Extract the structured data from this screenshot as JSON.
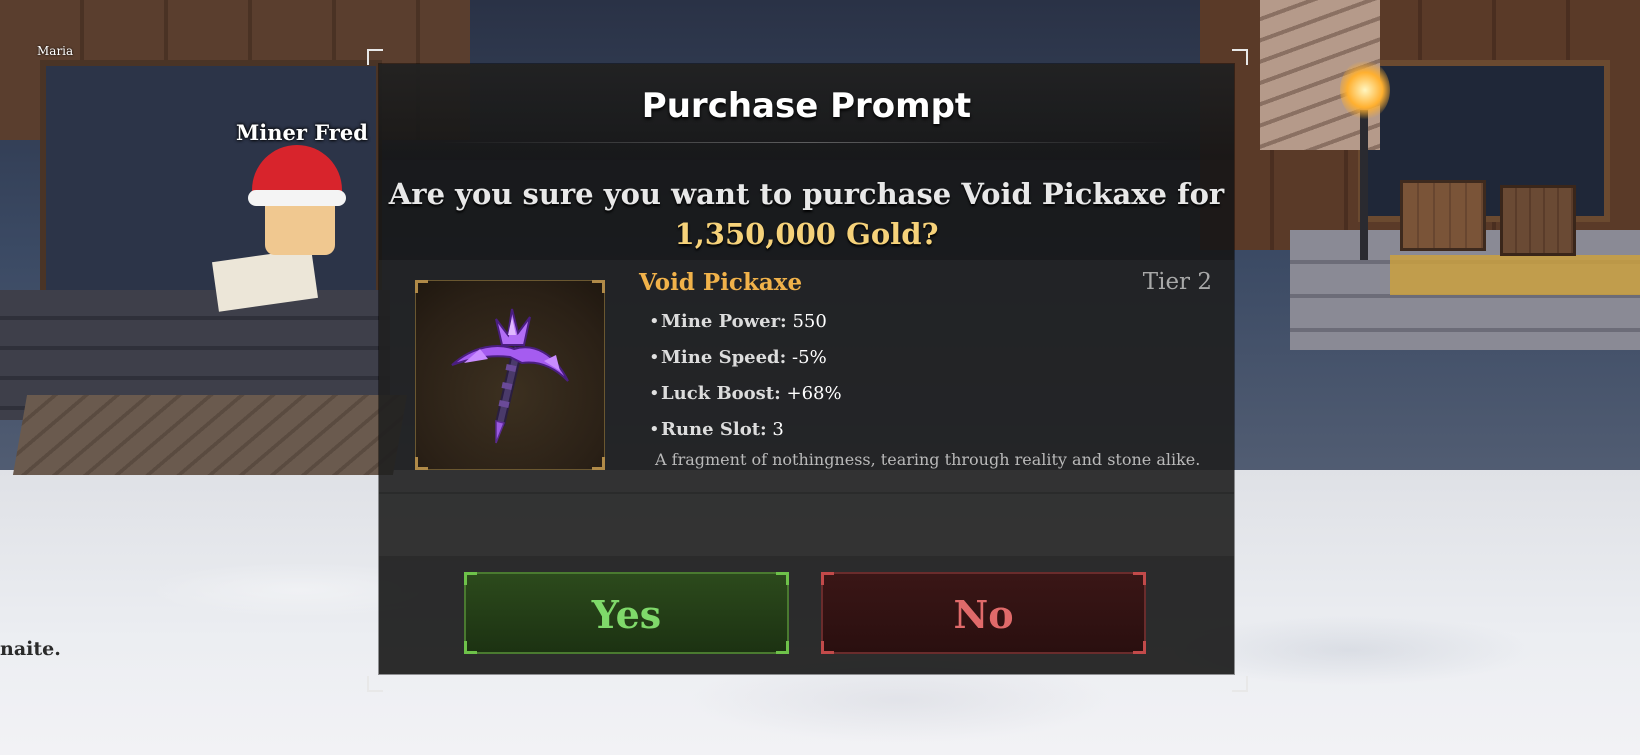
{
  "world": {
    "npc_name": "Miner Fred",
    "player_name": "Maria",
    "partial_name": "naite."
  },
  "dialog": {
    "title": "Purchase Prompt",
    "question_prefix": "Are you sure you want to purchase Void Pickaxe for",
    "price_text": "1,350,000 Gold?",
    "item": {
      "name": "Void Pickaxe",
      "tier": "Tier 2",
      "icon": "void-pickaxe-icon",
      "stats": [
        {
          "label": "Mine Power:",
          "value": "550"
        },
        {
          "label": "Mine Speed:",
          "value": "-5%"
        },
        {
          "label": "Luck Boost:",
          "value": "+68%"
        },
        {
          "label": "Rune Slot:",
          "value": "3"
        }
      ],
      "description": "A fragment of nothingness, tearing through reality and stone alike."
    },
    "yes_label": "Yes",
    "no_label": "No"
  },
  "colors": {
    "accent_gold": "#f6d27a",
    "item_name": "#f1b24a",
    "yes_text": "#7fd96a",
    "no_text": "#e06a6a"
  }
}
